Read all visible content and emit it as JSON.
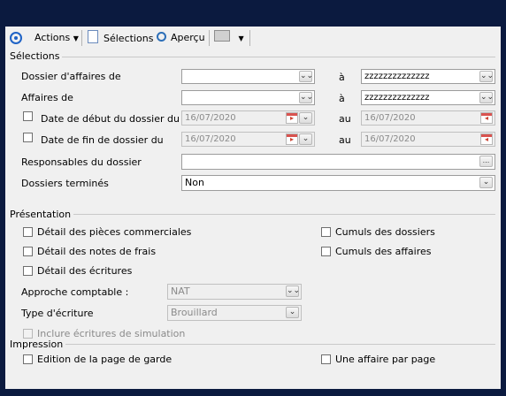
{
  "toolbar": {
    "actions_label": "Actions",
    "selections_label": "Sélections",
    "preview_label": "Aperçu"
  },
  "selections": {
    "section_title": "Sélections",
    "dossier_label": "Dossier d'affaires de",
    "dossier_from": "",
    "dossier_to_label": "à",
    "dossier_to": "zzzzzzzzzzzzzz",
    "affaires_label": "Affaires de",
    "affaires_from": "",
    "affaires_to_label": "à",
    "affaires_to": "zzzzzzzzzzzzzz",
    "start_date_label": "Date de début du dossier du",
    "start_date_from": "16/07/2020",
    "start_date_to_label": "au",
    "start_date_to": "16/07/2020",
    "end_date_label": "Date de fin de dossier du",
    "end_date_from": "16/07/2020",
    "end_date_to_label": "au",
    "end_date_to": "16/07/2020",
    "responsables_label": "Responsables du dossier",
    "responsables_value": "",
    "ellipsis": "...",
    "termines_label": "Dossiers terminés",
    "termines_value": "Non"
  },
  "presentation": {
    "section_title": "Présentation",
    "detail_pieces": "Détail des pièces commerciales",
    "detail_notes": "Détail des notes de frais",
    "detail_ecritures": "Détail des écritures",
    "cumuls_dossiers": "Cumuls des dossiers",
    "cumuls_affaires": "Cumuls des affaires",
    "approche_label": "Approche comptable :",
    "approche_value": "NAT",
    "type_label": "Type d'écriture",
    "type_value": "Brouillard",
    "simulation_label": "Inclure écritures de simulation"
  },
  "impression": {
    "section_title": "Impression",
    "page_garde": "Edition de la page de garde",
    "affaire_par_page": "Une affaire par page"
  },
  "colors": {
    "background": "#0b1a3f",
    "window": "#f0f0f0",
    "accent": "#1f63c6"
  }
}
